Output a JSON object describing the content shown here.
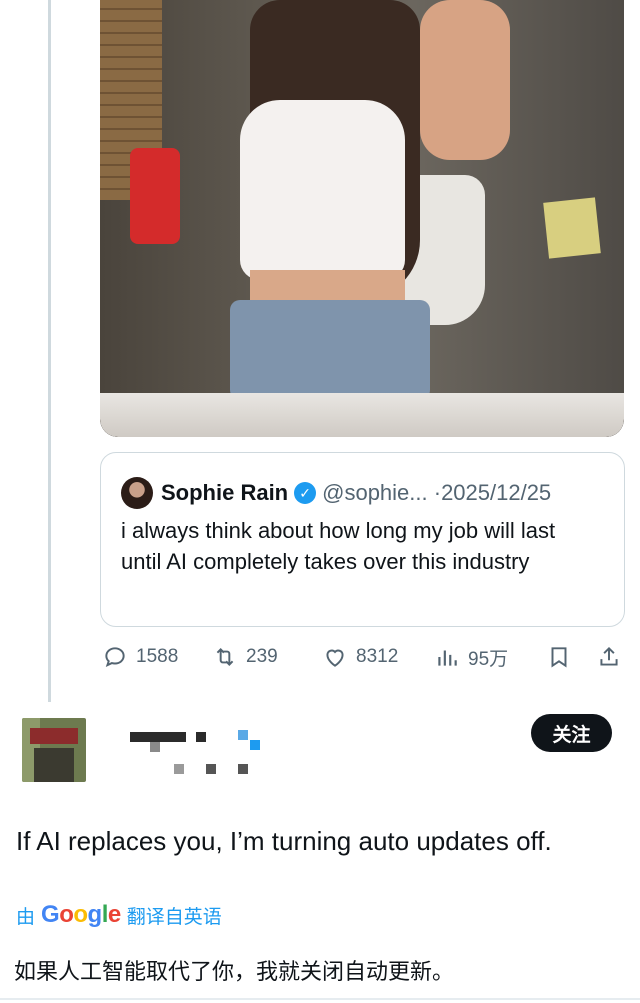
{
  "quoted_tweet": {
    "author_name": "Sophie Rain",
    "verified_mark": "✓",
    "handle_and_date": "@sophie... ·2025/12/25",
    "text": "i always think about how long my job will last until AI completely takes over this industry"
  },
  "actions": {
    "replies": "1588",
    "reposts": "239",
    "likes": "8312",
    "views": "95万"
  },
  "reply_tweet": {
    "follow_label": "关注",
    "text": "If AI replaces you, I’m turning auto updates off.",
    "translate_prefix": "由",
    "translate_suffix": "翻译自英语",
    "translated_text": "如果人工智能取代了你，我就关闭自动更新。"
  },
  "colors": {
    "accent": "#1d9bf0",
    "text": "#0f1419",
    "muted": "#536471",
    "border": "#cfd9de"
  },
  "icons": [
    "reply-icon",
    "repost-icon",
    "like-icon",
    "views-icon",
    "bookmark-icon",
    "share-icon",
    "verified-icon"
  ]
}
